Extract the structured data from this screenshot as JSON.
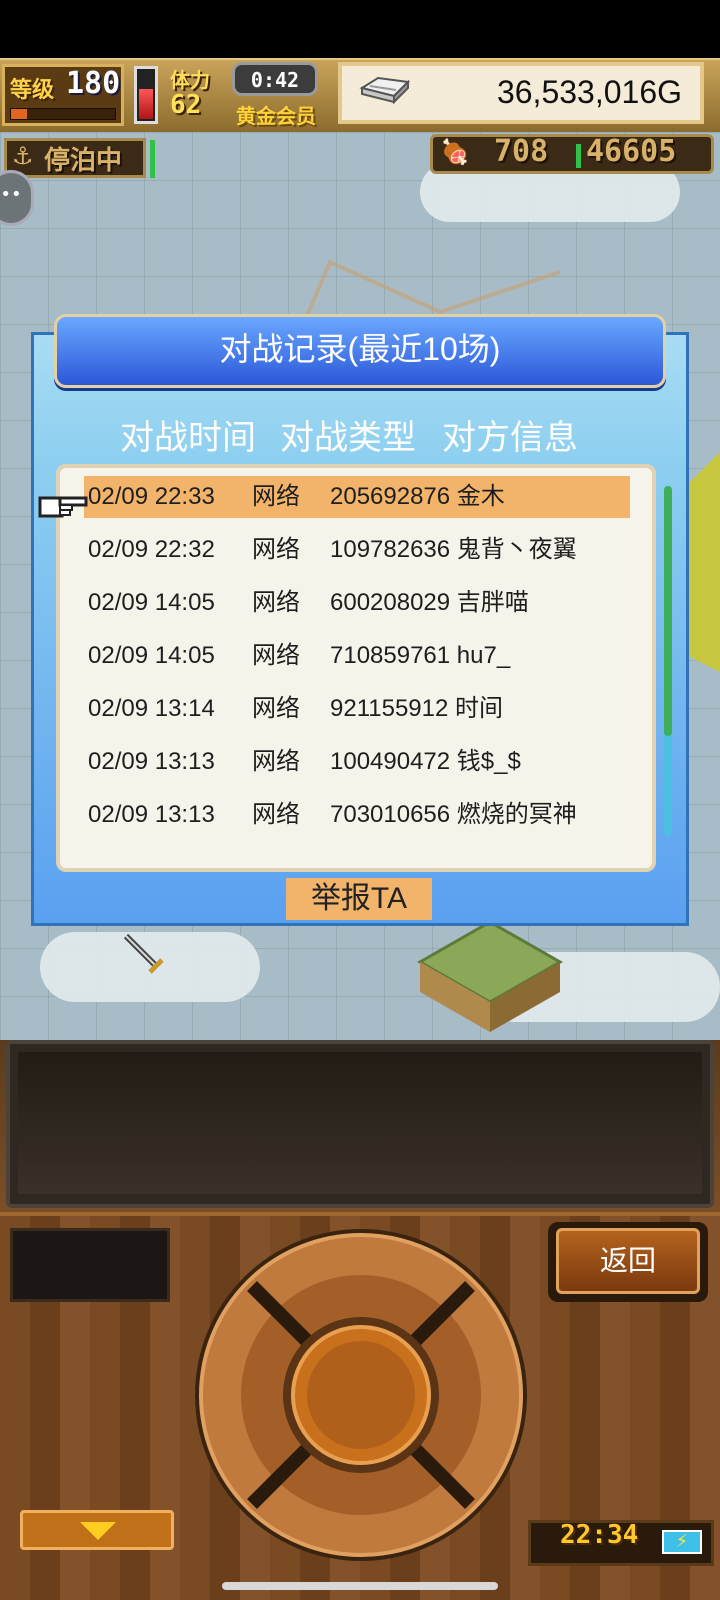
{
  "hud": {
    "level_label": "等级",
    "level_value": "180",
    "level_progress": 0.15,
    "stamina_label": "体力",
    "stamina_value": "62",
    "stamina_level": 0.65,
    "timer": "0:42",
    "member_label": "黄金会员",
    "gold_value": "36,533,016G"
  },
  "status": {
    "dock_label": "停泊中",
    "resource_a": "708",
    "resource_b": "46605"
  },
  "dialog": {
    "title": "对战记录(最近10场)",
    "headers": [
      "对战时间",
      "对战类型",
      "对方信息"
    ],
    "rows": [
      {
        "time": "02/09 22:33",
        "type": "网络",
        "info": "205692876 金木",
        "selected": true
      },
      {
        "time": "02/09 22:32",
        "type": "网络",
        "info": "109782636 鬼背丶夜翼"
      },
      {
        "time": "02/09 14:05",
        "type": "网络",
        "info": "600208029 吉胖喵"
      },
      {
        "time": "02/09 14:05",
        "type": "网络",
        "info": "710859761 hu7_"
      },
      {
        "time": "02/09 13:14",
        "type": "网络",
        "info": "921155912 时间"
      },
      {
        "time": "02/09 13:13",
        "type": "网络",
        "info": "100490472 钱$_$"
      },
      {
        "time": "02/09 13:13",
        "type": "网络",
        "info": "703010656 燃烧的冥神"
      }
    ],
    "report_label": "举报TA"
  },
  "controls": {
    "back_label": "返回",
    "clock": "22:34"
  },
  "colors": {
    "selected_row": "#f2b46a",
    "dialog_title_bg": "#2b58d8",
    "accent_gold": "#ffc82a"
  }
}
